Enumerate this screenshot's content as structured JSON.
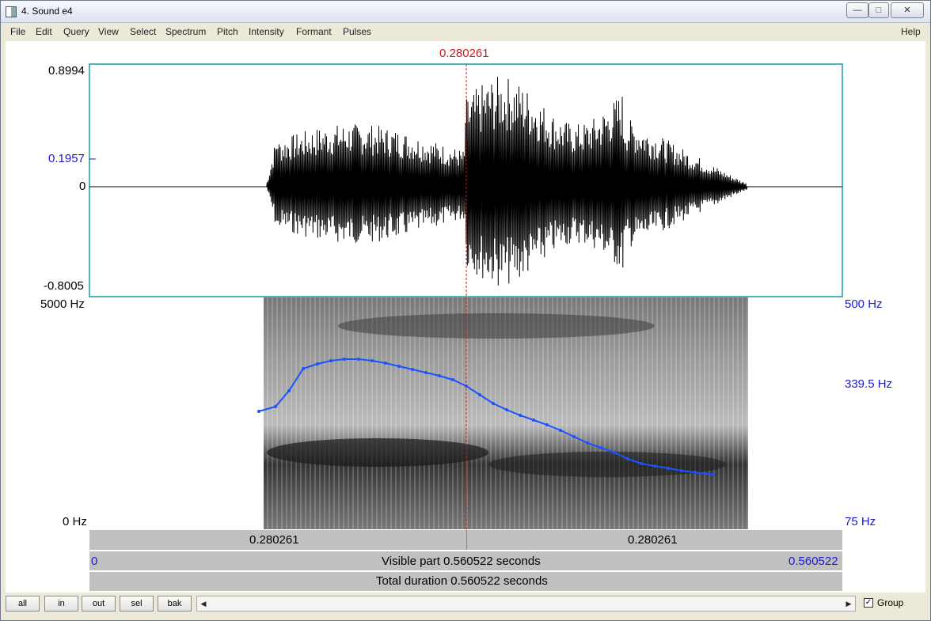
{
  "window": {
    "title": "4. Sound e4",
    "controls": [
      "minimize",
      "maximize",
      "close"
    ]
  },
  "menu": {
    "items": [
      "File",
      "Edit",
      "Query",
      "View",
      "Select",
      "Spectrum",
      "Pitch",
      "Intensity",
      "Formant",
      "Pulses"
    ],
    "help": "Help"
  },
  "waveform": {
    "cursor_time": "0.280261",
    "y_max": "0.8994",
    "y_mark": "0.1957",
    "y_zero": "0",
    "y_min": "-0.8005"
  },
  "spectrogram": {
    "freq_max": "5000 Hz",
    "freq_min": "0 Hz",
    "pitch_max": "500 Hz",
    "pitch_mid": "339.5 Hz",
    "pitch_min": "75 Hz",
    "pitch_color": "#1a52ff"
  },
  "time_bars": {
    "left_segment": "0.280261",
    "right_segment": "0.280261",
    "visible_start": "0",
    "visible_label": "Visible part 0.560522 seconds",
    "visible_end": "0.560522",
    "total_label": "Total duration 0.560522 seconds"
  },
  "bottom": {
    "buttons": [
      "all",
      "in",
      "out",
      "sel",
      "bak"
    ],
    "group_label": "Group",
    "group_checked": true
  }
}
